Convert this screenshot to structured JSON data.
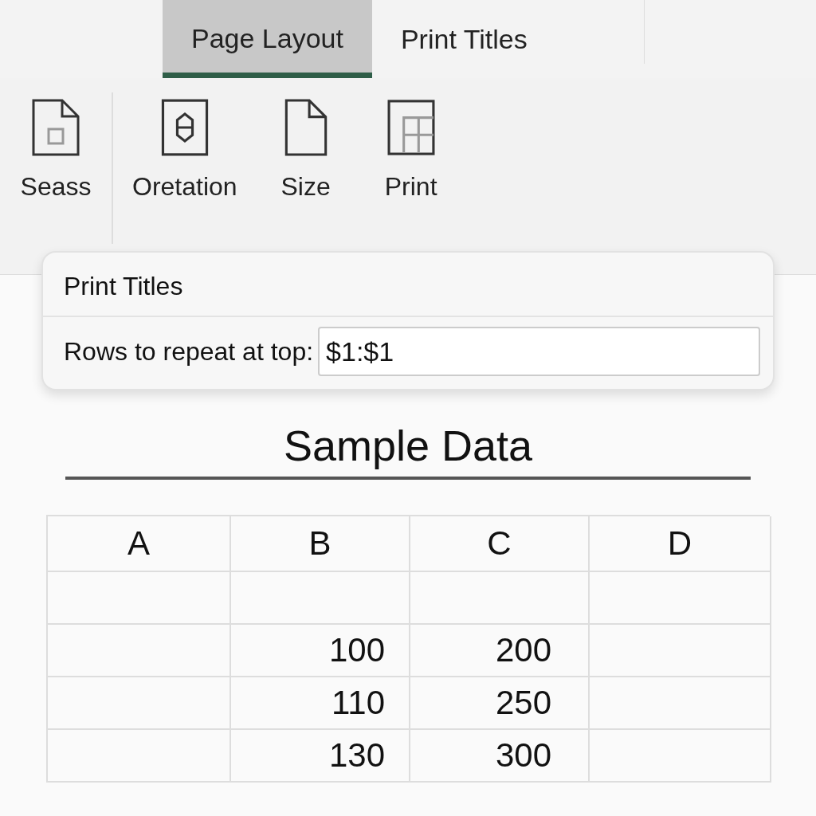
{
  "tabs": [
    {
      "label": "Page Layout",
      "selected": true
    },
    {
      "label": "Print Titles",
      "selected": false
    }
  ],
  "ribbon": {
    "groups": [
      [
        {
          "label": "Seass",
          "kind": "page-square"
        }
      ],
      [
        {
          "label": "Oretation",
          "kind": "orientation"
        },
        {
          "label": "Size",
          "kind": "page"
        },
        {
          "label": "Print",
          "kind": "grid"
        }
      ]
    ]
  },
  "popup": {
    "title": "Print Titles",
    "field_label": "Rows to repeat at top:",
    "field_value": "$1:$1"
  },
  "sheet": {
    "heading": "Sample Data",
    "table": {
      "columns": [
        "A",
        "B",
        "C",
        "D"
      ],
      "rows": [
        {
          "cells": [
            null,
            null,
            null,
            null
          ]
        },
        {
          "cells": [
            null,
            "100",
            "200",
            null
          ]
        },
        {
          "cells": [
            null,
            "110",
            "250",
            null
          ]
        },
        {
          "cells": [
            null,
            "130",
            "300",
            null
          ]
        }
      ]
    }
  }
}
